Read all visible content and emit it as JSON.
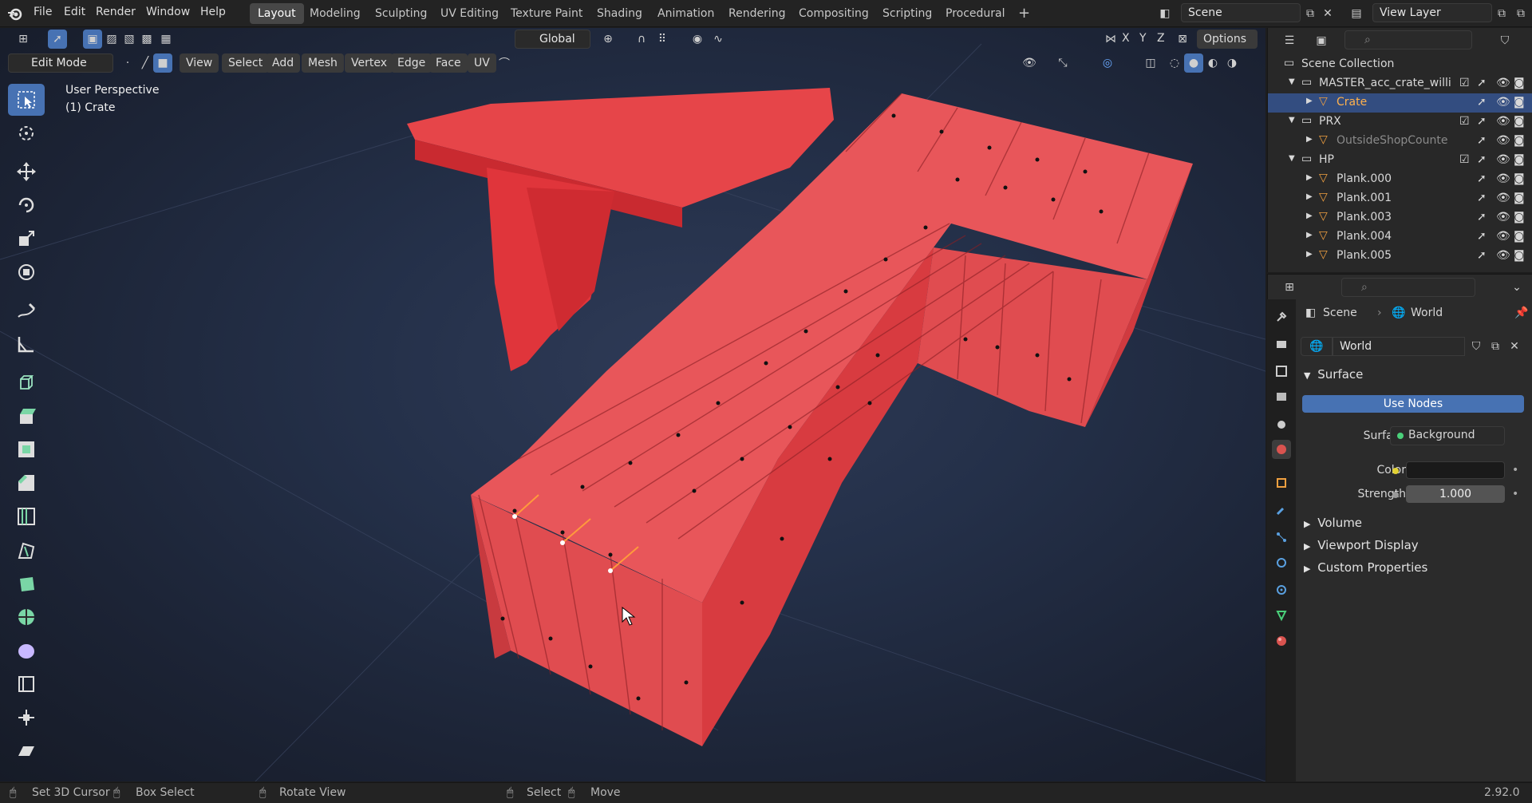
{
  "app": {
    "menus": [
      "File",
      "Edit",
      "Render",
      "Window",
      "Help"
    ],
    "workspaces": [
      "Layout",
      "Modeling",
      "Sculpting",
      "UV Editing",
      "Texture Paint",
      "Shading",
      "Animation",
      "Rendering",
      "Compositing",
      "Scripting",
      "Procedural"
    ],
    "active_workspace": "Layout",
    "scene_name": "Scene",
    "view_layer": "View Layer"
  },
  "viewport_header": {
    "transform_orientation": "Global",
    "axes": [
      "X",
      "Y",
      "Z"
    ],
    "options_label": "Options",
    "mode": "Edit Mode",
    "menus": [
      "View",
      "Select",
      "Add",
      "Mesh",
      "Vertex",
      "Edge",
      "Face",
      "UV"
    ]
  },
  "viewport": {
    "perspective_label": "User Perspective",
    "object_label": "(1) Crate",
    "mesh_color": "#e8474b",
    "mesh_dark": "#c92a30"
  },
  "outliner": {
    "rows": [
      {
        "label": "Scene Collection",
        "indent": 0,
        "kind": "collection"
      },
      {
        "label": "MASTER_acc_crate_willi",
        "indent": 1,
        "kind": "collection",
        "checked": true
      },
      {
        "label": "Crate",
        "indent": 2,
        "kind": "object",
        "selected": true
      },
      {
        "label": "PRX",
        "indent": 1,
        "kind": "collection",
        "checked": true
      },
      {
        "label": "OutsideShopCounte",
        "indent": 2,
        "kind": "object",
        "dim": true
      },
      {
        "label": "HP",
        "indent": 1,
        "kind": "collection",
        "checked": true
      },
      {
        "label": "Plank.000",
        "indent": 2,
        "kind": "object"
      },
      {
        "label": "Plank.001",
        "indent": 2,
        "kind": "object"
      },
      {
        "label": "Plank.003",
        "indent": 2,
        "kind": "object"
      },
      {
        "label": "Plank.004",
        "indent": 2,
        "kind": "object"
      },
      {
        "label": "Plank.005",
        "indent": 2,
        "kind": "object"
      }
    ]
  },
  "properties": {
    "breadcrumb_scene": "Scene",
    "breadcrumb_world": "World",
    "world_name": "World",
    "surface_panel": "Surface",
    "use_nodes_label": "Use Nodes",
    "surface_label": "Surface",
    "surface_value": "Background",
    "color_label": "Color",
    "color_value": "#1a1a1a",
    "strength_label": "Strength",
    "strength_value": "1.000",
    "collapsed_panels": [
      "Volume",
      "Viewport Display",
      "Custom Properties"
    ]
  },
  "statusbar": {
    "items": [
      "Set 3D Cursor",
      "Box Select",
      "Rotate View",
      "Select",
      "Move"
    ],
    "version": "2.92.0"
  }
}
